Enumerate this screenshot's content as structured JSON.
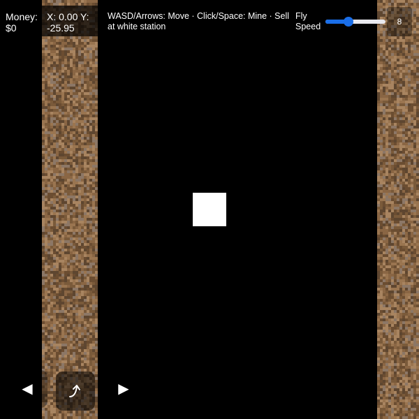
{
  "hud": {
    "money_label": "Money:",
    "money_value": "$0",
    "coords_text": "X: 0.00 Y: -25.95",
    "help_text": "WASD/Arrows: Move · Click/Space: Mine · Sell at white station",
    "fly_speed_label": "Fly Speed",
    "fly_speed_value": "8",
    "fly_speed_fraction": 0.38
  },
  "controls": {
    "left_glyph": "◀",
    "right_glyph": "▶",
    "jump_icon": "curved-up-arrow-icon"
  },
  "colors": {
    "background": "#000000",
    "station": "#ffffff",
    "slider_accent": "#1a6ee8",
    "dirt_palette": [
      "#7a5a3a",
      "#8a6644",
      "#6b4d31",
      "#9a7550",
      "#5e4630",
      "#8c7766",
      "#a88460"
    ]
  }
}
